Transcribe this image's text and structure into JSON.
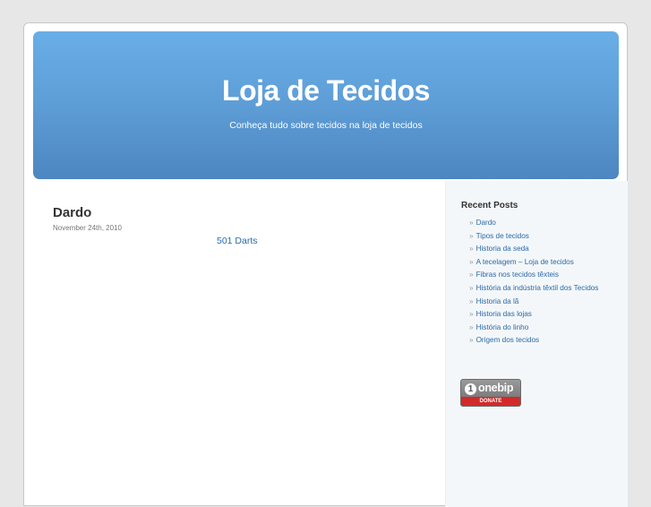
{
  "header": {
    "title": "Loja de Tecidos",
    "description": "Conheça tudo sobre tecidos na loja de tecidos"
  },
  "post": {
    "title": "Dardo",
    "date": "November 24th, 2010",
    "link_text": "501 Darts"
  },
  "sidebar": {
    "heading": "Recent Posts",
    "bullet": "»",
    "items": [
      "Dardo",
      "Tipos de tecidos",
      "Historia da seda",
      "A tecelagem – Loja de tecidos",
      "Fibras nos tecidos têxteis",
      "História da indústria têxtil dos Tecidos",
      "Historia da lã",
      "Historia das lojas",
      "História do linho",
      "Origem dos tecidos"
    ],
    "badge": {
      "mark": "1",
      "brand": "onebip",
      "action": "DONATE"
    }
  },
  "colors": {
    "header_gradient_top": "#69aee7",
    "header_gradient_bottom": "#4d86c0",
    "link": "#2a6aa8",
    "sidebar_bg": "#f4f7fa",
    "donate_red": "#d22a2a"
  }
}
